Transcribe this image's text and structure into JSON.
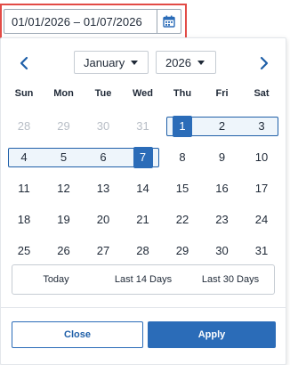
{
  "date_input": {
    "value": "01/01/2026 – 01/07/2026",
    "icon": "calendar-icon"
  },
  "calendar": {
    "prev_icon": "‹",
    "next_icon": "›",
    "month": "January",
    "year": "2026",
    "weekdays": [
      "Sun",
      "Mon",
      "Tue",
      "Wed",
      "Thu",
      "Fri",
      "Sat"
    ],
    "weeks": [
      [
        "28",
        "29",
        "30",
        "31",
        "1",
        "2",
        "3"
      ],
      [
        "4",
        "5",
        "6",
        "7",
        "8",
        "9",
        "10"
      ],
      [
        "11",
        "12",
        "13",
        "14",
        "15",
        "16",
        "17"
      ],
      [
        "18",
        "19",
        "20",
        "21",
        "22",
        "23",
        "24"
      ],
      [
        "25",
        "26",
        "27",
        "28",
        "29",
        "30",
        "31"
      ]
    ],
    "range_start": "1",
    "range_end": "7"
  },
  "quick_ranges": [
    "Today",
    "Last 14 Days",
    "Last 30 Days"
  ],
  "actions": {
    "close": "Close",
    "apply": "Apply"
  },
  "colors": {
    "accent": "#2b6cb8",
    "highlight": "#e24b46",
    "range_fill": "#eef5fb",
    "muted_text": "#b8bec6"
  }
}
